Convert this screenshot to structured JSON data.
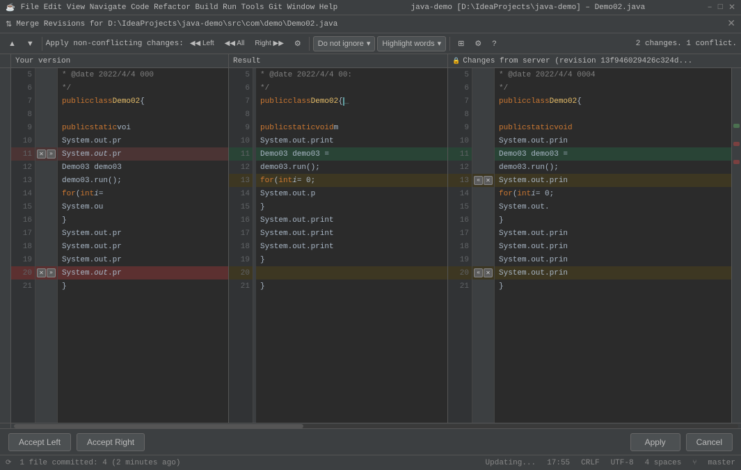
{
  "titlebar": {
    "title": "java-demo [D:\\IdeaProjects\\java-demo] – Demo02.java",
    "close_label": "✕",
    "min_label": "–",
    "max_label": "□"
  },
  "mergebar": {
    "title": "Merge Revisions for D:\\IdeaProjects\\java-demo\\src\\com\\demo\\Demo02.java",
    "close": "✕"
  },
  "toolbar": {
    "nav_up": "↑",
    "nav_down": "↓",
    "apply_label": "Apply non-conflicting changes:",
    "left_label": "◀◀ Left",
    "all_label": "◀◀ All",
    "right_label": "Right ▶▶",
    "settings_label": "⚙",
    "ignore_dropdown": "Do not ignore",
    "highlight_dropdown": "Highlight words",
    "columns_icon": "⊞",
    "gear_icon": "⚙",
    "help_icon": "?",
    "changes_info": "2 changes. 1 conflict."
  },
  "columns": {
    "your_version": "Your version",
    "result": "Result",
    "changes_from_server": "Changes from server (revision 13f946029426c324d..."
  },
  "panels": {
    "left": {
      "lines": [
        {
          "num": 5,
          "content": "* @date 2022/4/4 00:",
          "class": "comment"
        },
        {
          "num": 6,
          "content": "*/",
          "class": "comment"
        },
        {
          "num": 7,
          "content": "public class Demo02 {",
          "class": ""
        },
        {
          "num": 8,
          "content": "",
          "class": ""
        },
        {
          "num": 9,
          "content": "    public static voi",
          "class": ""
        },
        {
          "num": 10,
          "content": "        System.out.pr",
          "class": ""
        },
        {
          "num": 11,
          "content": "        System.out.pr",
          "class": "red"
        },
        {
          "num": 12,
          "content": "        Demo03 demo03",
          "class": ""
        },
        {
          "num": 13,
          "content": "        demo03.run();",
          "class": ""
        },
        {
          "num": 14,
          "content": "        for (int i =",
          "class": ""
        },
        {
          "num": 15,
          "content": "            System.ou",
          "class": ""
        },
        {
          "num": 16,
          "content": "        }",
          "class": ""
        },
        {
          "num": 17,
          "content": "        System.out.pr",
          "class": ""
        },
        {
          "num": 18,
          "content": "        System.out.pr",
          "class": ""
        },
        {
          "num": 19,
          "content": "        System.out.pr",
          "class": ""
        },
        {
          "num": 20,
          "content": "        System.out.pr",
          "class": "red2"
        },
        {
          "num": 21,
          "content": "    }",
          "class": ""
        }
      ]
    },
    "center": {
      "lines": [
        {
          "num": 5,
          "content": "* @date 2022/4/4 00:",
          "class": "comment"
        },
        {
          "num": 6,
          "content": "*/",
          "class": "comment"
        },
        {
          "num": 7,
          "content": "public class Demo02 {",
          "class": ""
        },
        {
          "num": 8,
          "content": "",
          "class": ""
        },
        {
          "num": 9,
          "content": "    public static void m",
          "class": ""
        },
        {
          "num": 10,
          "content": "        System.out.print",
          "class": ""
        },
        {
          "num": 11,
          "content": "        Demo03 demo03 =",
          "class": "green"
        },
        {
          "num": 12,
          "content": "        demo03.run();",
          "class": ""
        },
        {
          "num": 13,
          "content": "        for (int i = 0;",
          "class": "conflict"
        },
        {
          "num": 14,
          "content": "            System.out.p",
          "class": ""
        },
        {
          "num": 15,
          "content": "        }",
          "class": ""
        },
        {
          "num": 16,
          "content": "        System.out.print",
          "class": ""
        },
        {
          "num": 17,
          "content": "        System.out.print",
          "class": ""
        },
        {
          "num": 18,
          "content": "        System.out.print",
          "class": ""
        },
        {
          "num": 19,
          "content": "        }",
          "class": ""
        },
        {
          "num": 20,
          "content": "",
          "class": "conflict2"
        },
        {
          "num": 21,
          "content": "    }",
          "class": ""
        }
      ]
    },
    "right": {
      "lines": [
        {
          "num": 5,
          "content": "* @date 2022/4/4 0004",
          "class": "comment"
        },
        {
          "num": 6,
          "content": "*/",
          "class": "comment"
        },
        {
          "num": 7,
          "content": "public class Demo02 {",
          "class": ""
        },
        {
          "num": 8,
          "content": "",
          "class": ""
        },
        {
          "num": 9,
          "content": "    public static void",
          "class": ""
        },
        {
          "num": 10,
          "content": "        System.out.prin",
          "class": ""
        },
        {
          "num": 11,
          "content": "        Demo03 demo03 =",
          "class": "green"
        },
        {
          "num": 12,
          "content": "        demo03.run();",
          "class": ""
        },
        {
          "num": 13,
          "content": "        System.out.prin",
          "class": "conflict"
        },
        {
          "num": 14,
          "content": "        for (int i = 0;",
          "class": ""
        },
        {
          "num": 15,
          "content": "            System.out.",
          "class": ""
        },
        {
          "num": 16,
          "content": "        }",
          "class": ""
        },
        {
          "num": 17,
          "content": "        System.out.prin",
          "class": ""
        },
        {
          "num": 18,
          "content": "        System.out.prin",
          "class": ""
        },
        {
          "num": 19,
          "content": "        System.out.prin",
          "class": ""
        },
        {
          "num": 20,
          "content": "        System.out.prin",
          "class": "conflict2"
        },
        {
          "num": 21,
          "content": "    }",
          "class": ""
        }
      ]
    }
  },
  "buttons": {
    "accept_left": "Accept Left",
    "accept_right": "Accept Right",
    "apply": "Apply",
    "cancel": "Cancel"
  },
  "statusbar": {
    "left": "1 file committed: 4 (2 minutes ago)",
    "center": "Updating...",
    "time": "17:55",
    "encoding": "CRLF",
    "charset": "UTF-8",
    "indent": "4 spaces",
    "branch": "master"
  }
}
